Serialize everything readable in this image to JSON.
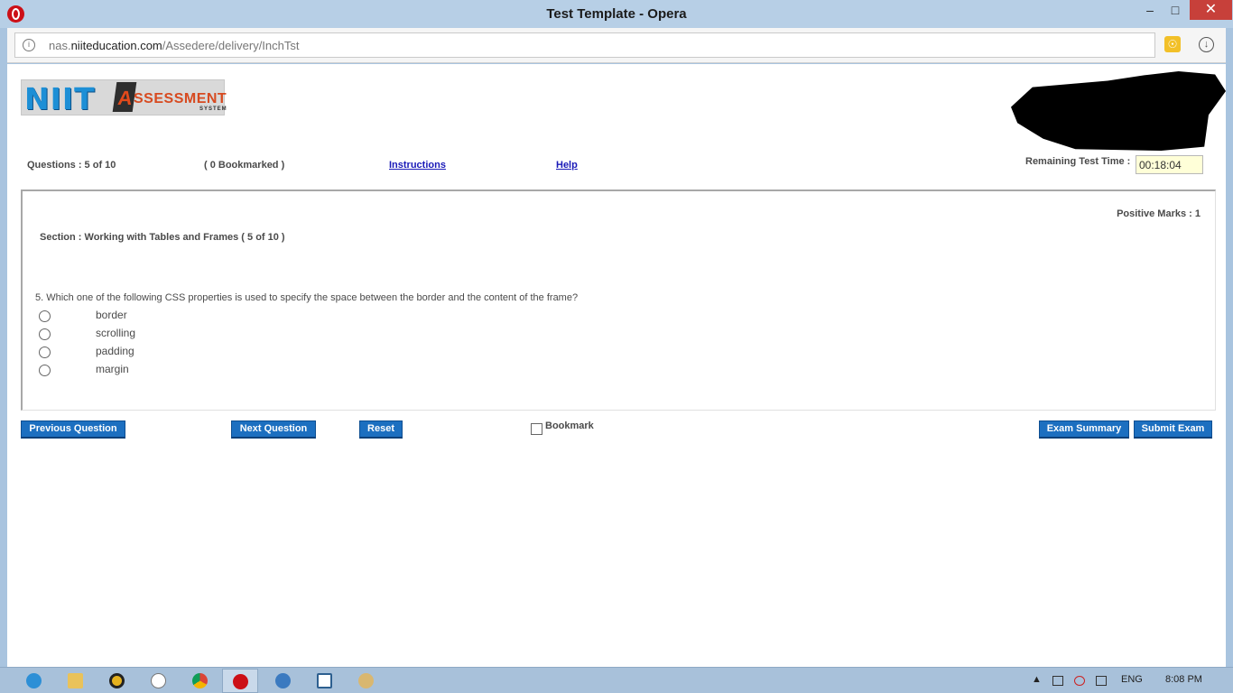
{
  "window": {
    "title": "Test Template - Opera"
  },
  "address_bar": {
    "url_prefix": "nas.",
    "url_domain": "niiteducation.com",
    "url_path": "/Assedere/delivery/InchTst"
  },
  "logo": {
    "brand": "NIIT",
    "badge_letter": "A",
    "product": "SSESSMENT",
    "sub": "SYSTEM"
  },
  "header": {
    "questions": "Questions : 5 of 10",
    "bookmarked": "( 0 Bookmarked )",
    "instructions": "Instructions",
    "help": "Help",
    "remaining_label": "Remaining Test Time :",
    "remaining_time": "00:18:04"
  },
  "question_panel": {
    "positive_marks": "Positive Marks : 1",
    "section": "Section : Working with Tables and Frames ( 5 of 10 )",
    "question": "5. Which one of the following CSS properties is used to specify the space between the border and the content of the frame?",
    "options": [
      "border",
      "scrolling",
      "padding",
      "margin"
    ]
  },
  "buttons": {
    "previous": "Previous Question",
    "next": "Next Question",
    "reset": "Reset",
    "bookmark": "Bookmark",
    "exam_summary": "Exam Summary",
    "submit": "Submit Exam"
  },
  "taskbar": {
    "apps": [
      "internet-explorer-icon",
      "file-explorer-icon",
      "media-player-icon",
      "hp-icon",
      "chrome-icon",
      "opera-icon",
      "app-icon",
      "window-icon",
      "paint-icon"
    ],
    "language": "ENG",
    "time": "8:08 PM"
  },
  "colors": {
    "button_blue": "#1c6fc0",
    "link_blue": "#1a1ab8",
    "timer_bg": "#ffffd8",
    "close_red": "#c7403a"
  }
}
